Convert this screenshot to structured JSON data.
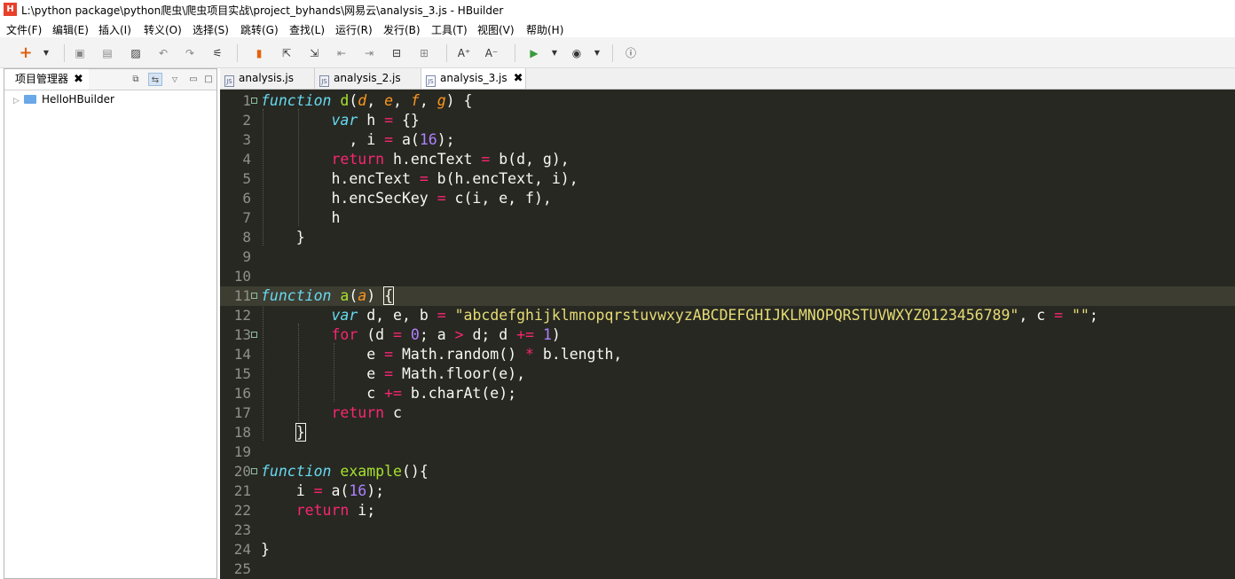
{
  "window": {
    "title": "L:\\python package\\python爬虫\\爬虫项目实战\\project_byhands\\网易云\\analysis_3.js  -  HBuilder",
    "app_icon": "H"
  },
  "menu": [
    "文件(F)",
    "编辑(E)",
    "插入(I)",
    "转义(O)",
    "选择(S)",
    "跳转(G)",
    "查找(L)",
    "运行(R)",
    "发行(B)",
    "工具(T)",
    "视图(V)",
    "帮助(H)"
  ],
  "project_panel": {
    "tab_label": "项目管理器",
    "close_glyph": "✖",
    "tree": [
      {
        "label": "HelloHBuilder",
        "icon": "folder-icon"
      }
    ]
  },
  "tabs": [
    {
      "label": "analysis.js",
      "icon": "js-file-icon",
      "active": false
    },
    {
      "label": "analysis_2.js",
      "icon": "js-file-icon",
      "active": false
    },
    {
      "label": "analysis_3.js",
      "icon": "js-file-icon",
      "active": true,
      "close_glyph": "✖"
    }
  ],
  "editor": {
    "line_numbers": [
      "1",
      "2",
      "3",
      "4",
      "5",
      "6",
      "7",
      "8",
      "9",
      "10",
      "11",
      "12",
      "13",
      "14",
      "15",
      "16",
      "17",
      "18",
      "19",
      "20",
      "21",
      "22",
      "23",
      "24",
      "25"
    ],
    "current_line": 11,
    "theme_colors": {
      "background": "#272822",
      "keyword": "#f92672",
      "function_name": "#a6e22e",
      "parameter": "#fd971f",
      "number": "#ae81ff",
      "string": "#e6db74",
      "storage": "#66d9ef"
    },
    "code_lines": [
      "function d(d, e, f, g) {",
      "        var h = {}",
      "          , i = a(16);",
      "        return h.encText = b(d, g),",
      "        h.encText = b(h.encText, i),",
      "        h.encSecKey = c(i, e, f),",
      "        h",
      "    }",
      "",
      "",
      "function a(a) {",
      "        var d, e, b = \"abcdefghijklmnopqrstuvwxyzABCDEFGHIJKLMNOPQRSTUVWXYZ0123456789\", c = \"\";",
      "        for (d = 0; a > d; d += 1)",
      "            e = Math.random() * b.length,",
      "            e = Math.floor(e),",
      "            c += b.charAt(e);",
      "        return c",
      "    }",
      "",
      "function example(){",
      "    i = a(16);",
      "    return i;",
      "",
      "}",
      ""
    ]
  }
}
